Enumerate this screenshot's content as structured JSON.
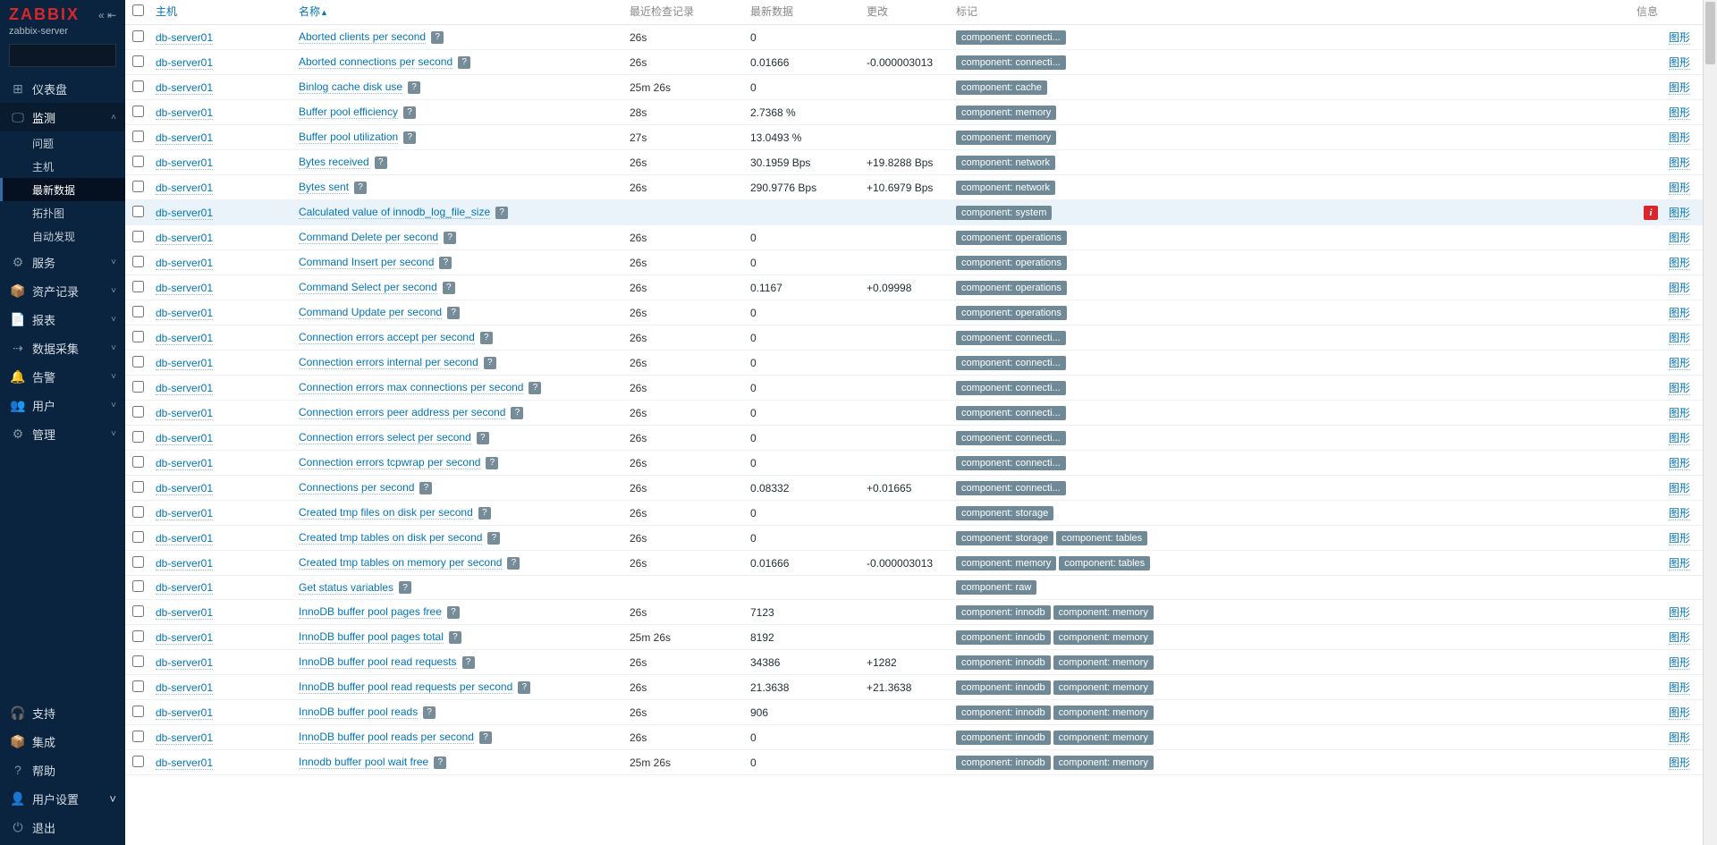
{
  "sidebar": {
    "logo": "ZABBIX",
    "server": "zabbix-server",
    "search_placeholder": "",
    "nav": [
      {
        "icon": "⊞",
        "label": "仪表盘",
        "active": false,
        "expandable": false
      },
      {
        "icon": "🖵",
        "label": "监测",
        "active": true,
        "expandable": true,
        "children": [
          {
            "label": "问题",
            "active": false
          },
          {
            "label": "主机",
            "active": false
          },
          {
            "label": "最新数据",
            "active": true
          },
          {
            "label": "拓扑图",
            "active": false
          },
          {
            "label": "自动发现",
            "active": false
          }
        ]
      },
      {
        "icon": "⚙",
        "label": "服务",
        "expandable": true
      },
      {
        "icon": "📦",
        "label": "资产记录",
        "expandable": true
      },
      {
        "icon": "📄",
        "label": "报表",
        "expandable": true
      },
      {
        "icon": "⇢",
        "label": "数据采集",
        "expandable": true
      },
      {
        "icon": "🔔",
        "label": "告警",
        "expandable": true
      },
      {
        "icon": "👥",
        "label": "用户",
        "expandable": true
      },
      {
        "icon": "⚙",
        "label": "管理",
        "expandable": true
      }
    ],
    "footer": [
      {
        "icon": "🎧",
        "label": "支持"
      },
      {
        "icon": "📦",
        "label": "集成"
      },
      {
        "icon": "?",
        "label": "帮助"
      },
      {
        "icon": "👤",
        "label": "用户设置",
        "expandable": true
      },
      {
        "icon": "⏻",
        "label": "退出"
      }
    ]
  },
  "table": {
    "headers": {
      "host": "主机",
      "name": "名称",
      "last": "最近检查记录",
      "value": "最新数据",
      "change": "更改",
      "tags": "标记",
      "info": "信息"
    },
    "graph_text": "图形",
    "rows": [
      {
        "host": "db-server01",
        "name": "Aborted clients per second",
        "help": true,
        "last": "26s",
        "value": "0",
        "change": "",
        "tags": [
          "component: connecti..."
        ],
        "graph": true,
        "hover": false
      },
      {
        "host": "db-server01",
        "name": "Aborted connections per second",
        "help": true,
        "last": "26s",
        "value": "0.01666",
        "change": "-0.000003013",
        "tags": [
          "component: connecti..."
        ],
        "graph": true,
        "hover": false
      },
      {
        "host": "db-server01",
        "name": "Binlog cache disk use",
        "help": true,
        "last": "25m 26s",
        "value": "0",
        "change": "",
        "tags": [
          "component: cache"
        ],
        "graph": true,
        "hover": false
      },
      {
        "host": "db-server01",
        "name": "Buffer pool efficiency",
        "help": true,
        "last": "28s",
        "value": "2.7368 %",
        "change": "",
        "tags": [
          "component: memory"
        ],
        "graph": true,
        "hover": false
      },
      {
        "host": "db-server01",
        "name": "Buffer pool utilization",
        "help": true,
        "last": "27s",
        "value": "13.0493 %",
        "change": "",
        "tags": [
          "component: memory"
        ],
        "graph": true,
        "hover": false
      },
      {
        "host": "db-server01",
        "name": "Bytes received",
        "help": true,
        "last": "26s",
        "value": "30.1959 Bps",
        "change": "+19.8288 Bps",
        "tags": [
          "component: network"
        ],
        "graph": true,
        "hover": false
      },
      {
        "host": "db-server01",
        "name": "Bytes sent",
        "help": true,
        "last": "26s",
        "value": "290.9776 Bps",
        "change": "+10.6979 Bps",
        "tags": [
          "component: network"
        ],
        "graph": true,
        "hover": false
      },
      {
        "host": "db-server01",
        "name": "Calculated value of innodb_log_file_size",
        "help": true,
        "last": "",
        "value": "",
        "change": "",
        "tags": [
          "component: system"
        ],
        "graph": true,
        "hover": true,
        "info": true
      },
      {
        "host": "db-server01",
        "name": "Command Delete per second",
        "help": true,
        "last": "26s",
        "value": "0",
        "change": "",
        "tags": [
          "component: operations"
        ],
        "graph": true,
        "hover": false
      },
      {
        "host": "db-server01",
        "name": "Command Insert per second",
        "help": true,
        "last": "26s",
        "value": "0",
        "change": "",
        "tags": [
          "component: operations"
        ],
        "graph": true,
        "hover": false
      },
      {
        "host": "db-server01",
        "name": "Command Select per second",
        "help": true,
        "last": "26s",
        "value": "0.1167",
        "change": "+0.09998",
        "tags": [
          "component: operations"
        ],
        "graph": true,
        "hover": false
      },
      {
        "host": "db-server01",
        "name": "Command Update per second",
        "help": true,
        "last": "26s",
        "value": "0",
        "change": "",
        "tags": [
          "component: operations"
        ],
        "graph": true,
        "hover": false
      },
      {
        "host": "db-server01",
        "name": "Connection errors accept per second",
        "help": true,
        "last": "26s",
        "value": "0",
        "change": "",
        "tags": [
          "component: connecti..."
        ],
        "graph": true,
        "hover": false
      },
      {
        "host": "db-server01",
        "name": "Connection errors internal per second",
        "help": true,
        "last": "26s",
        "value": "0",
        "change": "",
        "tags": [
          "component: connecti..."
        ],
        "graph": true,
        "hover": false
      },
      {
        "host": "db-server01",
        "name": "Connection errors max connections per second",
        "help": true,
        "last": "26s",
        "value": "0",
        "change": "",
        "tags": [
          "component: connecti..."
        ],
        "graph": true,
        "hover": false
      },
      {
        "host": "db-server01",
        "name": "Connection errors peer address per second",
        "help": true,
        "last": "26s",
        "value": "0",
        "change": "",
        "tags": [
          "component: connecti..."
        ],
        "graph": true,
        "hover": false
      },
      {
        "host": "db-server01",
        "name": "Connection errors select per second",
        "help": true,
        "last": "26s",
        "value": "0",
        "change": "",
        "tags": [
          "component: connecti..."
        ],
        "graph": true,
        "hover": false
      },
      {
        "host": "db-server01",
        "name": "Connection errors tcpwrap per second",
        "help": true,
        "last": "26s",
        "value": "0",
        "change": "",
        "tags": [
          "component: connecti..."
        ],
        "graph": true,
        "hover": false
      },
      {
        "host": "db-server01",
        "name": "Connections per second",
        "help": true,
        "last": "26s",
        "value": "0.08332",
        "change": "+0.01665",
        "tags": [
          "component: connecti..."
        ],
        "graph": true,
        "hover": false
      },
      {
        "host": "db-server01",
        "name": "Created tmp files on disk per second",
        "help": true,
        "last": "26s",
        "value": "0",
        "change": "",
        "tags": [
          "component: storage"
        ],
        "graph": true,
        "hover": false
      },
      {
        "host": "db-server01",
        "name": "Created tmp tables on disk per second",
        "help": true,
        "last": "26s",
        "value": "0",
        "change": "",
        "tags": [
          "component: storage",
          "component: tables"
        ],
        "graph": true,
        "hover": false
      },
      {
        "host": "db-server01",
        "name": "Created tmp tables on memory per second",
        "help": true,
        "last": "26s",
        "value": "0.01666",
        "change": "-0.000003013",
        "tags": [
          "component: memory",
          "component: tables"
        ],
        "graph": true,
        "hover": false
      },
      {
        "host": "db-server01",
        "name": "Get status variables",
        "help": true,
        "last": "",
        "value": "",
        "change": "",
        "tags": [
          "component: raw"
        ],
        "graph": false,
        "hover": false
      },
      {
        "host": "db-server01",
        "name": "InnoDB buffer pool pages free",
        "help": true,
        "last": "26s",
        "value": "7123",
        "change": "",
        "tags": [
          "component: innodb",
          "component: memory"
        ],
        "graph": true,
        "hover": false
      },
      {
        "host": "db-server01",
        "name": "InnoDB buffer pool pages total",
        "help": true,
        "last": "25m 26s",
        "value": "8192",
        "change": "",
        "tags": [
          "component: innodb",
          "component: memory"
        ],
        "graph": true,
        "hover": false
      },
      {
        "host": "db-server01",
        "name": "InnoDB buffer pool read requests",
        "help": true,
        "last": "26s",
        "value": "34386",
        "change": "+1282",
        "tags": [
          "component: innodb",
          "component: memory"
        ],
        "graph": true,
        "hover": false
      },
      {
        "host": "db-server01",
        "name": "InnoDB buffer pool read requests per second",
        "help": true,
        "last": "26s",
        "value": "21.3638",
        "change": "+21.3638",
        "tags": [
          "component: innodb",
          "component: memory"
        ],
        "graph": true,
        "hover": false
      },
      {
        "host": "db-server01",
        "name": "InnoDB buffer pool reads",
        "help": true,
        "last": "26s",
        "value": "906",
        "change": "",
        "tags": [
          "component: innodb",
          "component: memory"
        ],
        "graph": true,
        "hover": false
      },
      {
        "host": "db-server01",
        "name": "InnoDB buffer pool reads per second",
        "help": true,
        "last": "26s",
        "value": "0",
        "change": "",
        "tags": [
          "component: innodb",
          "component: memory"
        ],
        "graph": true,
        "hover": false
      },
      {
        "host": "db-server01",
        "name": "Innodb buffer pool wait free",
        "help": true,
        "last": "25m 26s",
        "value": "0",
        "change": "",
        "tags": [
          "component: innodb",
          "component: memory"
        ],
        "graph": true,
        "hover": false
      }
    ]
  }
}
